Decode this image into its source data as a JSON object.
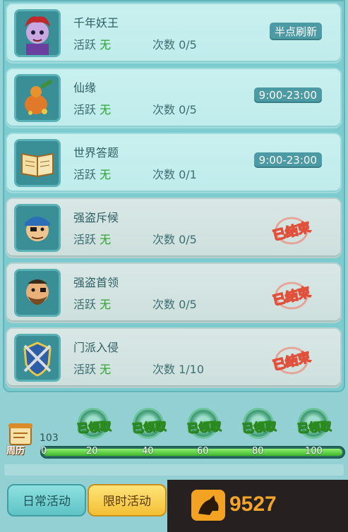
{
  "activities": [
    {
      "name": "千年妖王",
      "active_label": "活跃",
      "active_value": "无",
      "count_label": "次数",
      "count_value": "0/5",
      "status": "半点刷新",
      "state": "open",
      "avatar_icon": "demon-king-avatar-icon"
    },
    {
      "name": "仙缘",
      "active_label": "活跃",
      "active_value": "无",
      "count_label": "次数",
      "count_value": "0/5",
      "status": "9:00-23:00",
      "state": "open",
      "avatar_icon": "gourd-avatar-icon"
    },
    {
      "name": "世界答题",
      "active_label": "活跃",
      "active_value": "无",
      "count_label": "次数",
      "count_value": "0/1",
      "status": "9:00-23:00",
      "state": "open",
      "avatar_icon": "book-avatar-icon"
    },
    {
      "name": "强盗斥候",
      "active_label": "活跃",
      "active_value": "无",
      "count_label": "次数",
      "count_value": "0/5",
      "status": "已结束",
      "state": "ended",
      "avatar_icon": "bandit-scout-avatar-icon"
    },
    {
      "name": "强盗首领",
      "active_label": "活跃",
      "active_value": "无",
      "count_label": "次数",
      "count_value": "0/5",
      "status": "已结束",
      "state": "ended",
      "avatar_icon": "bandit-leader-avatar-icon"
    },
    {
      "name": "门派入侵",
      "active_label": "活跃",
      "active_value": "无",
      "count_label": "次数",
      "count_value": "1/10",
      "status": "已结束",
      "state": "ended",
      "avatar_icon": "sect-invasion-shield-icon"
    }
  ],
  "progress": {
    "calendar_label": "周历",
    "score": "103",
    "fraction": 1.0,
    "ticks": [
      "0",
      "20",
      "40",
      "60",
      "80",
      "100"
    ],
    "rewards": [
      "已领取",
      "已领取",
      "已领取",
      "已领取",
      "已领取"
    ]
  },
  "tabs": {
    "daily": "日常活动",
    "limited": "限时活动"
  },
  "ad": {
    "text": "9527"
  },
  "colors": {
    "active_value": "#2ea32e",
    "badge": "#4c9aa3",
    "tab_daily": "#5fc3c5",
    "tab_limited": "#f3bf34",
    "progress_fill": "#3fb52d"
  }
}
